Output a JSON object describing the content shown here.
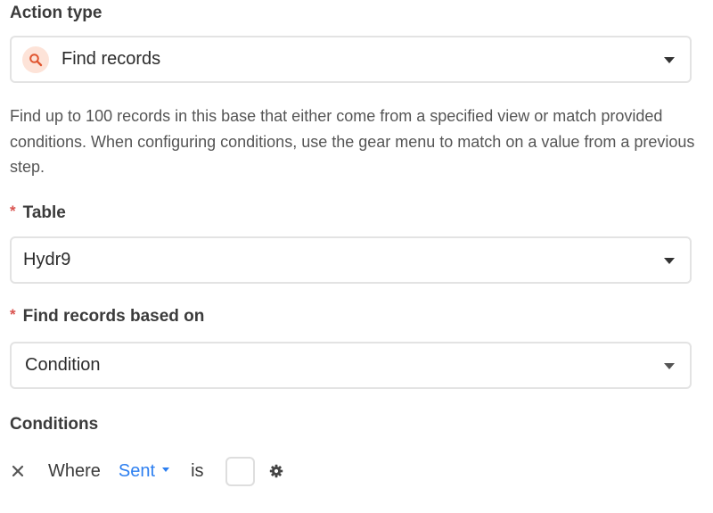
{
  "action_type": {
    "label": "Action type",
    "value": "Find records",
    "icon": "search-icon",
    "icon_bg": "#fde3d8",
    "icon_color": "#e0552f"
  },
  "description": "Find up to 100 records in this base that either come from a specified view or match provided conditions. When configuring conditions, use the gear menu to match on a value from a previous step.",
  "table": {
    "required": "*",
    "label": "Table",
    "value": "Hydr9"
  },
  "find_based_on": {
    "required": "*",
    "label": "Find records based on",
    "value": "Condition"
  },
  "conditions": {
    "label": "Conditions",
    "rows": [
      {
        "prefix": "Where",
        "field": "Sent",
        "operator": "is",
        "checked": false
      }
    ]
  },
  "colors": {
    "accent_blue": "#2d7ff0",
    "required_red": "#d9534f",
    "border": "#e3e3e3"
  }
}
